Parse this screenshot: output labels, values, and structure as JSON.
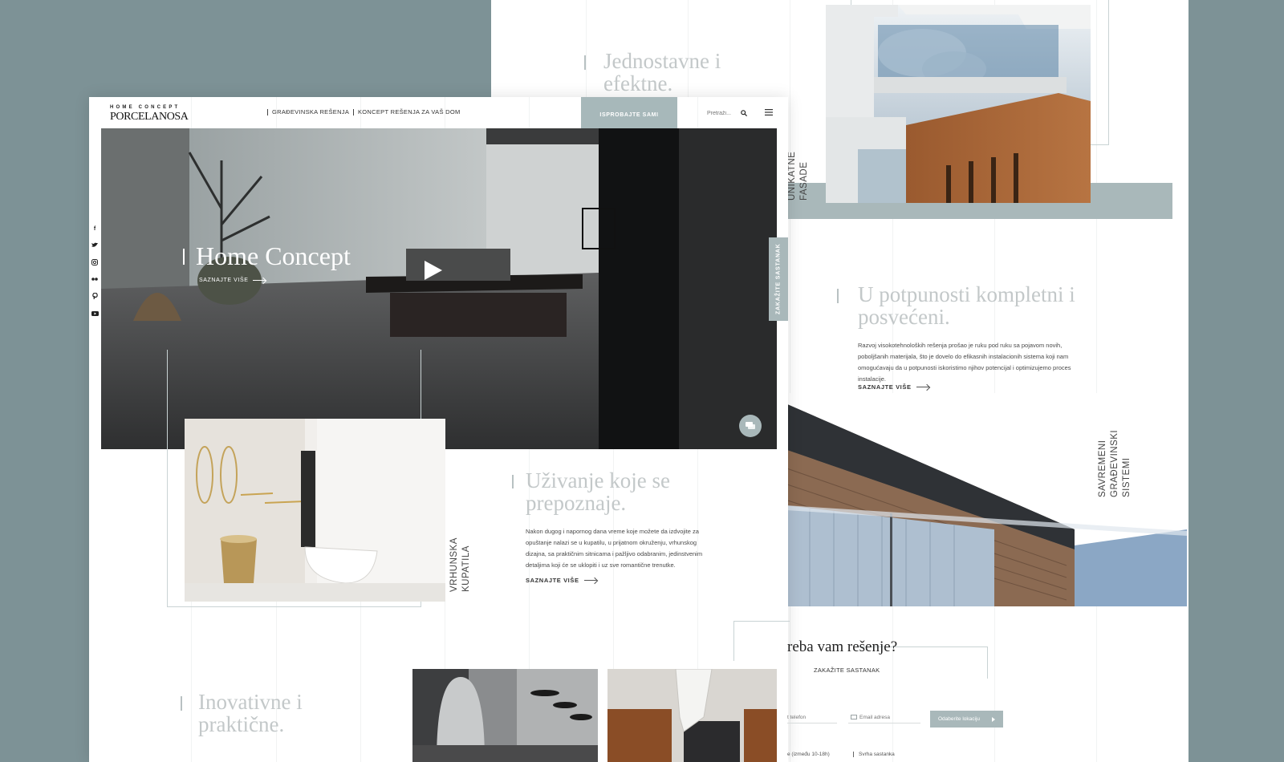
{
  "back_page": {
    "hero_heading": "Jednostavne i efektne.",
    "facade_label": "Unikatne fasade",
    "complete_heading": "U potpunosti kompletni i posvećeni.",
    "complete_body": "Razvoj visokotehnoloških rešenja prošao je ruku pod ruku sa pojavom novih, poboljšanih materijala, što je dovelo do efikasnih instalacionih sistema koji nam omogućavaju da u potpunosti iskoristimo njihov potencijal i optimizujemo proces instalacije.",
    "complete_more": "SAZNAJTE VIŠE",
    "systems_label": "Savremeni građevinski sistemi",
    "form": {
      "heading": "reba vam rešenje?",
      "subheading": "ZAKAŽITE SASTANAK",
      "phone_placeholder": "t telefon",
      "email_placeholder": "Email adresa",
      "location_label": "Odaberite lokaciju",
      "time_label": "e (između 10-18h)",
      "purpose_label": "Svrha sastanka"
    }
  },
  "front_page": {
    "logo": {
      "top": "HOME CONCEPT",
      "main": "PORCELANOSA"
    },
    "nav": {
      "links": [
        "GRAĐEVINSKA REŠENJA",
        "KONCEPT REŠENJA ZA VAŠ DOM"
      ],
      "cta": "ISPROBAJTE SAMI",
      "search_placeholder": "Pretraži..."
    },
    "social": [
      "f",
      "t",
      "ig",
      "fl",
      "p",
      "yt"
    ],
    "hero": {
      "title": "Home Concept",
      "more": "SAZNAJTE VIŠE",
      "meeting_tab": "ZAKAŽITE SASTANAK"
    },
    "bath": {
      "label": "Vrhunska kupatila",
      "heading": "Uživanje koje se prepoznaje.",
      "body": "Nakon dugog i napornog dana vreme koje možete da izdvojite za opuštanje nalazi se u kupatilu, u prijatnom okruženju, vrhunskog dizajna, sa praktičnim sitnicama i pažljivo odabranim, jedinstvenim detaljima koji će se uklopiti i uz sve romantične trenutke.",
      "more": "SAZNAJTE VIŠE"
    },
    "innovative_heading": "Inovativne i praktične."
  },
  "colors": {
    "background": "#7d9296",
    "accent": "#a9b8ba",
    "heading_light": "#c3c8c9"
  }
}
